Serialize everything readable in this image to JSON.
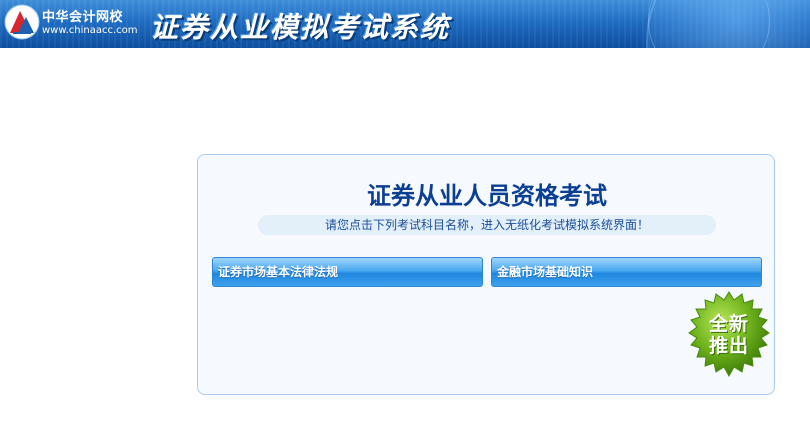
{
  "header": {
    "logo_name": "中华会计网校",
    "logo_url": "www.chinaacc.com",
    "system_title": "证券从业模拟考试系统",
    "colors": {
      "banner_top": "#3f8ed8",
      "banner_bottom": "#0d4f9e"
    }
  },
  "main": {
    "title": "证券从业人员资格考试",
    "notice": "请您点击下列考试科目名称，进入无纸化考试模拟系统界面！",
    "subjects": [
      {
        "label": "证券市场基本法律法规"
      },
      {
        "label": "金融市场基础知识"
      }
    ],
    "badge": {
      "line1": "全新",
      "line2": "推出",
      "color": "#6fb31c"
    }
  }
}
